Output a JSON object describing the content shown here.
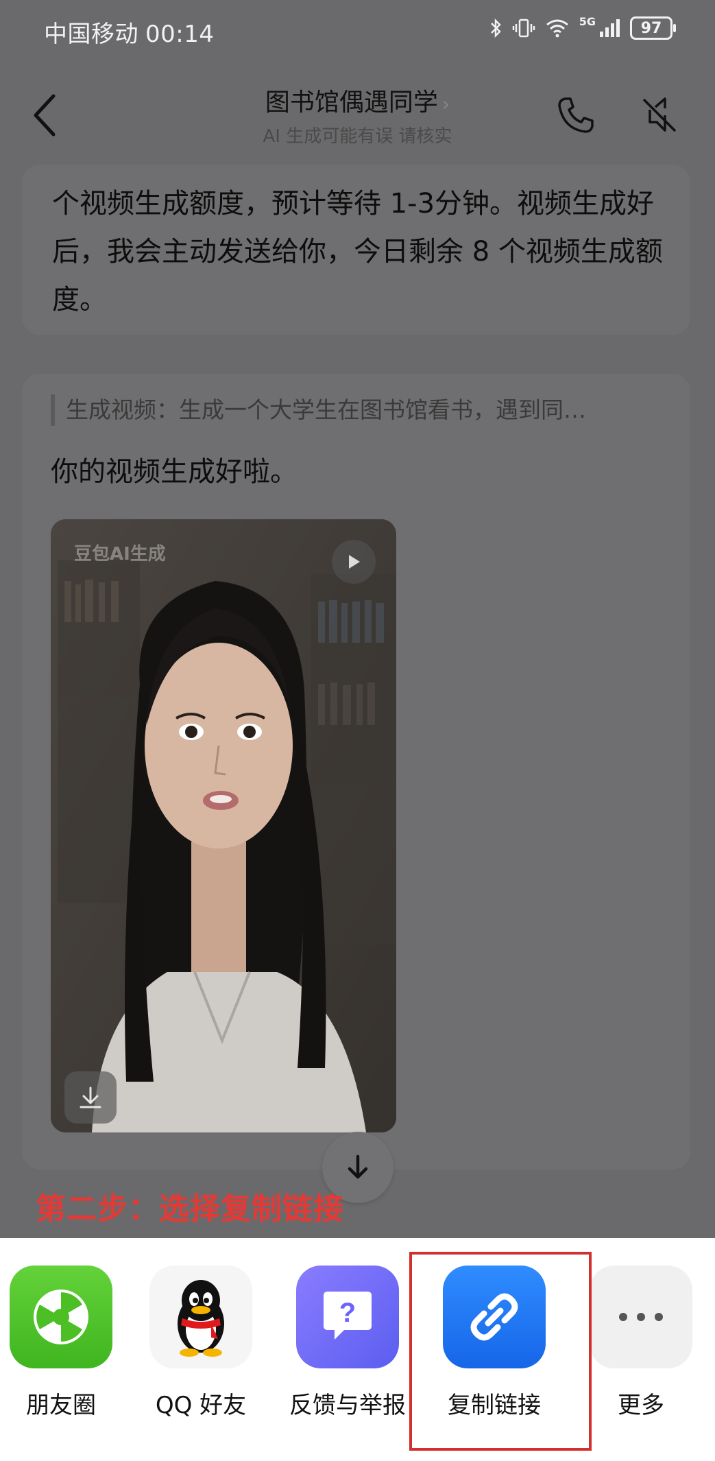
{
  "status_bar": {
    "carrier": "中国移动",
    "time": "00:14",
    "network": "5G",
    "battery": "97",
    "icons": [
      "bluetooth-icon",
      "vibrate-icon",
      "wifi-icon",
      "signal-icon",
      "battery-icon"
    ]
  },
  "header": {
    "title": "图书馆偶遇同学",
    "title_chevron": "›",
    "subtitle": "AI 生成可能有误 请核实",
    "icons": [
      "back-arrow-icon",
      "phone-icon",
      "mute-icon"
    ]
  },
  "chat": {
    "message1": "个视频生成额度，预计等待 1-3分钟。视频生成好后，我会主动发送给你，今日剩余 8 个视频生成额度。",
    "quote": "生成视频：生成一个大学生在图书馆看书，遇到同…",
    "reply": "你的视频生成好啦。",
    "video": {
      "watermark": "豆包AI生成",
      "icons": [
        "play-icon",
        "download-icon"
      ]
    }
  },
  "annotation": "第二步：选择复制链接",
  "share_sheet": {
    "items": [
      {
        "label": "朋友圈",
        "icon": "moments-icon",
        "color": "#52c41a"
      },
      {
        "label": "QQ 好友",
        "icon": "qq-penguin-icon",
        "color": "#f5f5f5"
      },
      {
        "label": "反馈与举报",
        "icon": "feedback-icon",
        "color": "#6c63ff"
      },
      {
        "label": "复制链接",
        "icon": "link-icon",
        "color": "#1a73e8"
      },
      {
        "label": "更多",
        "icon": "more-icon",
        "color": "#f0f0f0"
      }
    ]
  },
  "colors": {
    "annotation": "#e53935",
    "highlight_border": "#d32f2f",
    "overlay": "#6a6a6c"
  }
}
